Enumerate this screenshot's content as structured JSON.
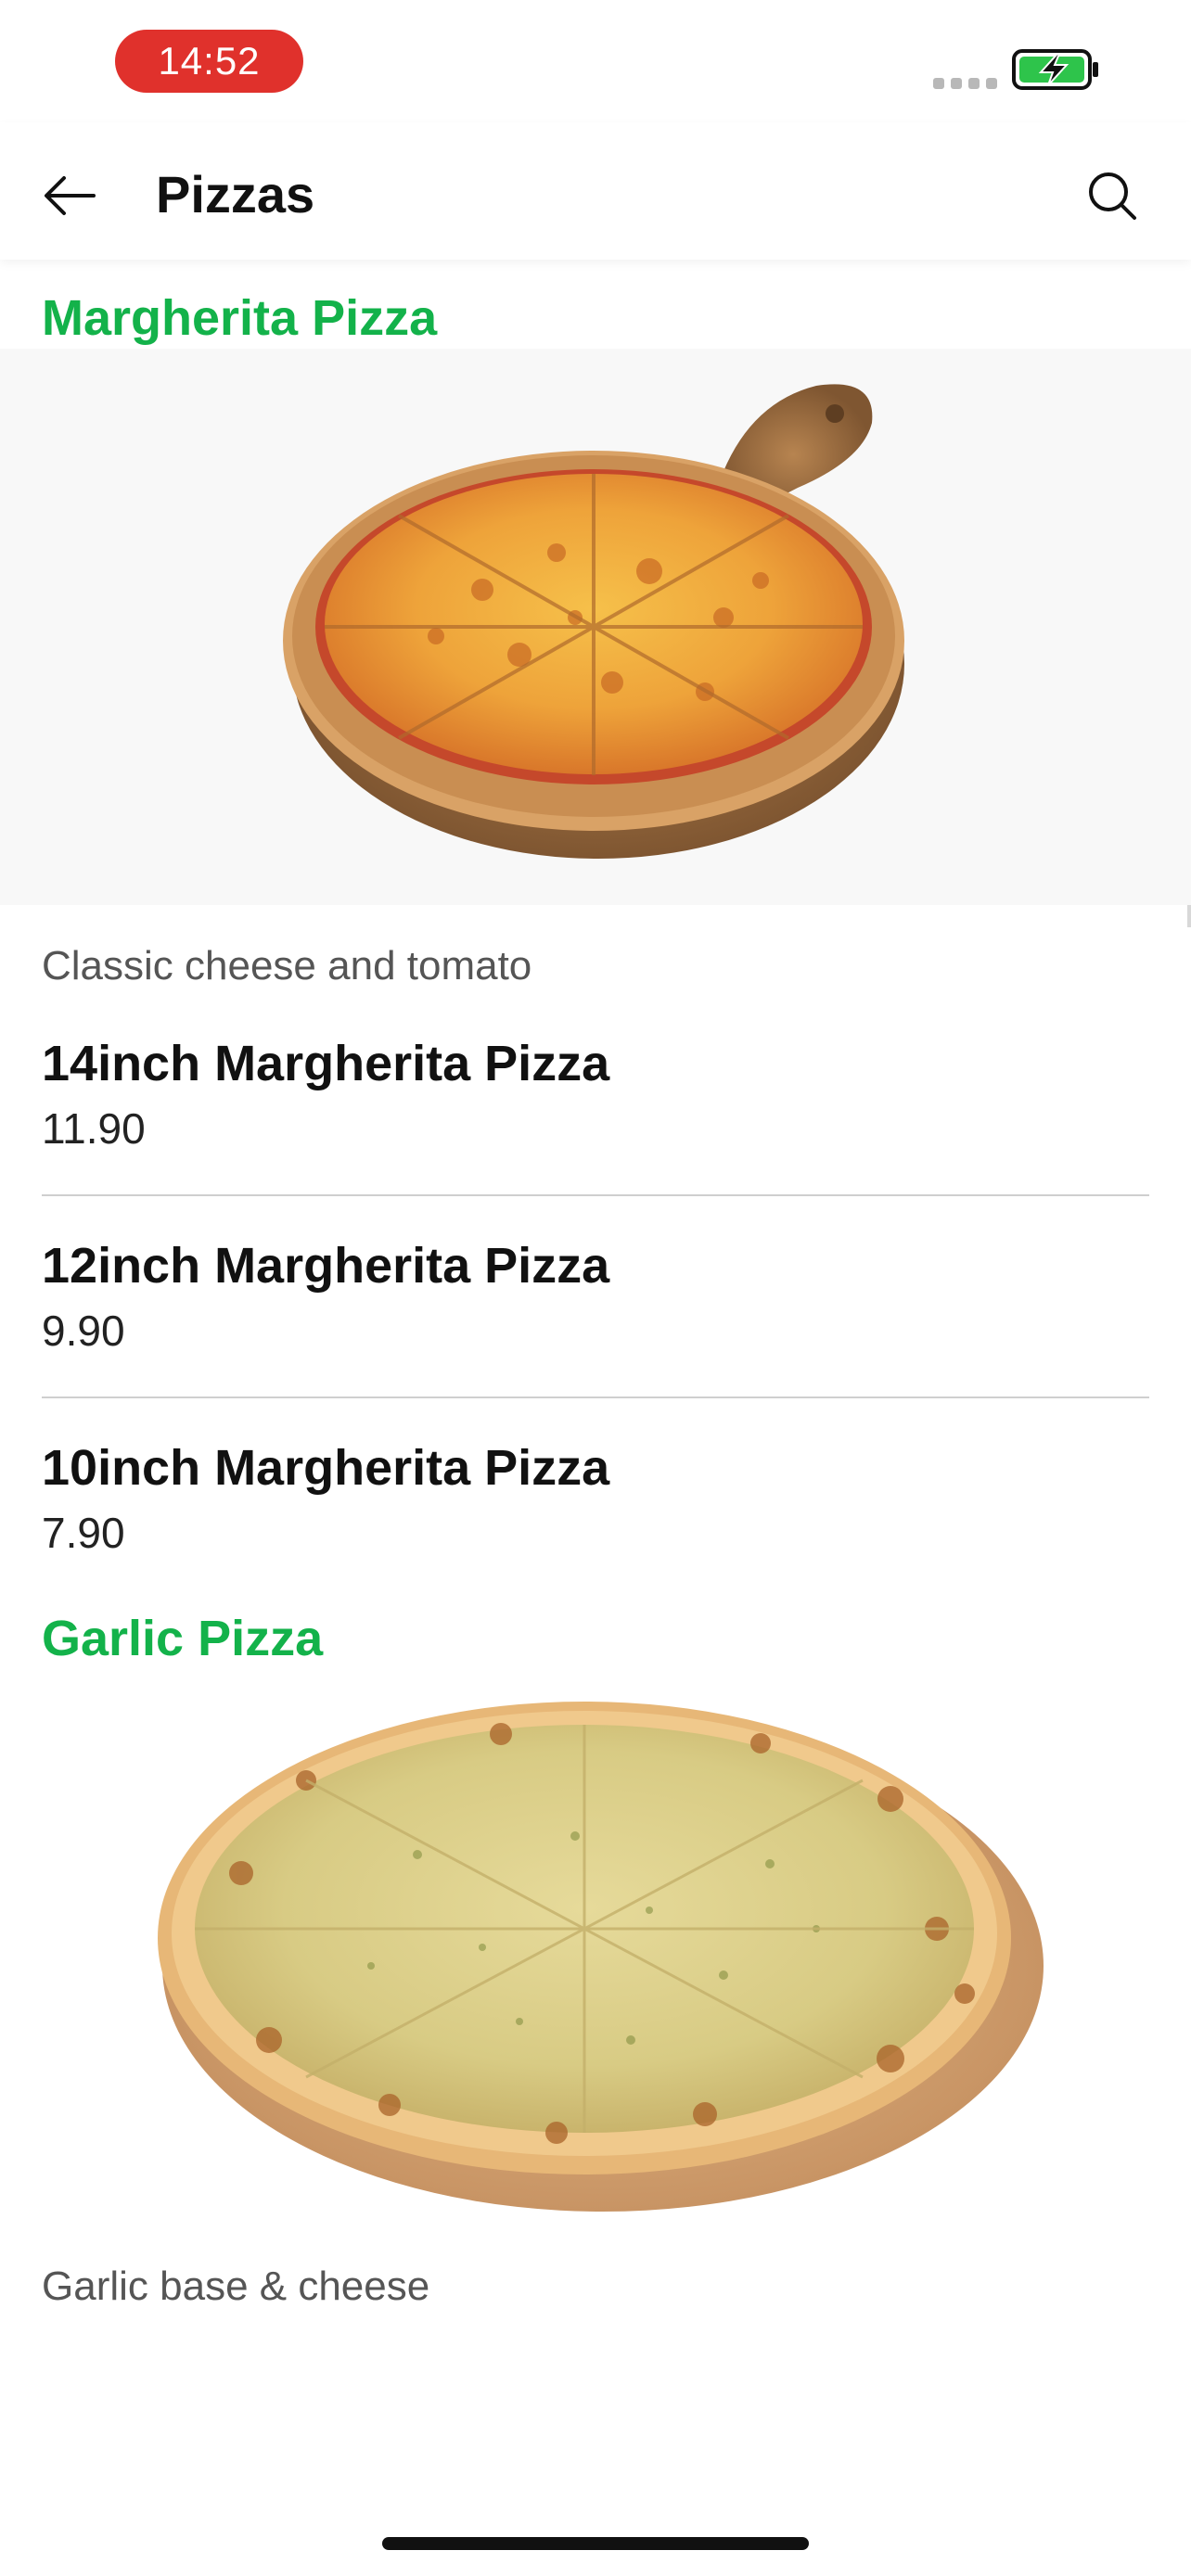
{
  "status_bar": {
    "time": "14:52",
    "signal_icon": "signal-dots-icon",
    "battery_icon": "battery-charging-icon",
    "battery_color": "#2ec44b"
  },
  "header": {
    "title": "Pizzas",
    "back_icon": "arrow-left-icon",
    "search_icon": "search-icon"
  },
  "accent_color": "#13b24a",
  "sections": [
    {
      "title": "Margherita Pizza",
      "image": "margherita-pizza-photo",
      "description": "Classic cheese and tomato",
      "items": [
        {
          "name": "14inch Margherita Pizza",
          "price": "11.90"
        },
        {
          "name": "12inch Margherita Pizza",
          "price": "9.90"
        },
        {
          "name": "10inch Margherita Pizza",
          "price": "7.90"
        }
      ]
    },
    {
      "title": "Garlic Pizza",
      "image": "garlic-pizza-photo",
      "description": "Garlic base & cheese",
      "items": []
    }
  ]
}
